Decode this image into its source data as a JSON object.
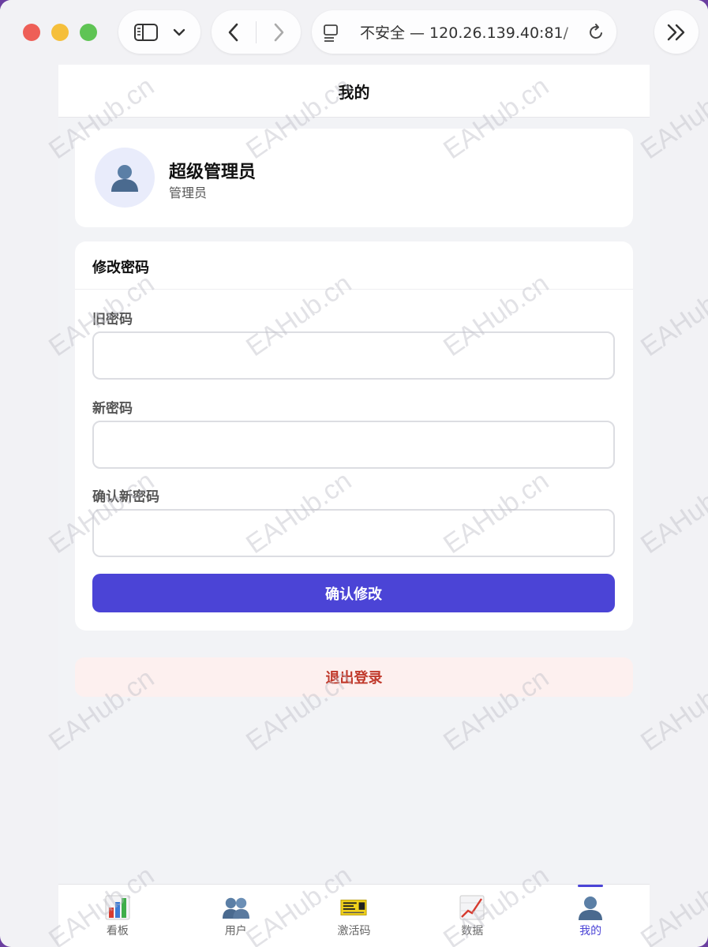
{
  "browser": {
    "url_text": "不安全 — 120.26.139.40:81/",
    "icons": {
      "sidebar": "sidebar-icon",
      "dropdown": "chevron-down-icon",
      "back": "chevron-left-icon",
      "forward": "chevron-right-icon",
      "reader": "reader-icon",
      "reload": "reload-icon",
      "more": "double-chevron-right-icon"
    }
  },
  "header": {
    "title": "我的"
  },
  "profile": {
    "name": "超级管理员",
    "role": "管理员",
    "avatar_icon": "user-avatar-icon"
  },
  "password_form": {
    "title": "修改密码",
    "old_label": "旧密码",
    "old_value": "",
    "new_label": "新密码",
    "new_value": "",
    "confirm_label": "确认新密码",
    "confirm_value": "",
    "submit_label": "确认修改"
  },
  "logout_label": "退出登录",
  "tabs": [
    {
      "label": "看板",
      "icon": "bar-chart-icon",
      "active": false
    },
    {
      "label": "用户",
      "icon": "users-icon",
      "active": false
    },
    {
      "label": "激活码",
      "icon": "ticket-icon",
      "active": false
    },
    {
      "label": "数据",
      "icon": "line-chart-icon",
      "active": false
    },
    {
      "label": "我的",
      "icon": "person-icon",
      "active": true
    }
  ],
  "watermark_text": "EAHub.cn",
  "colors": {
    "primary": "#4b44d6",
    "danger": "#c0392b",
    "danger_bg": "#fdf0ef",
    "page_bg": "#f2f3f6"
  }
}
